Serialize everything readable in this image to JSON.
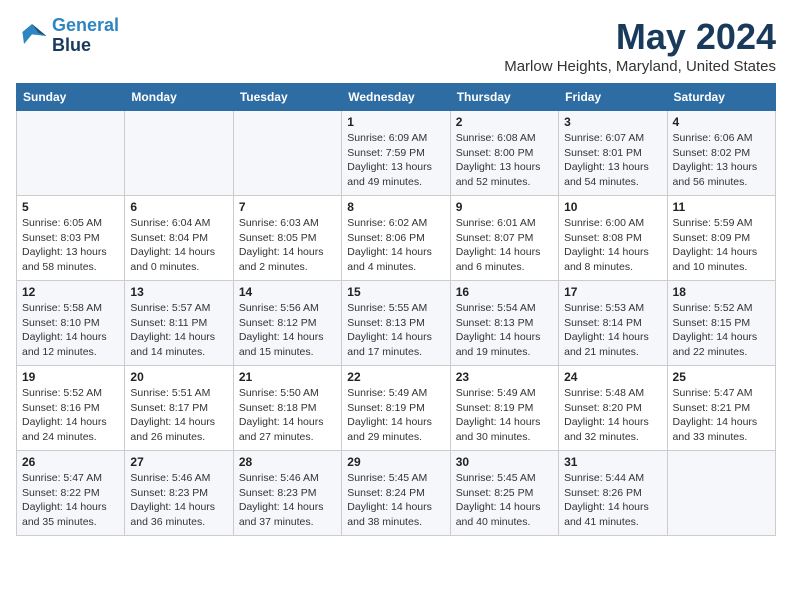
{
  "logo": {
    "line1": "General",
    "line2": "Blue"
  },
  "title": "May 2024",
  "location": "Marlow Heights, Maryland, United States",
  "weekdays": [
    "Sunday",
    "Monday",
    "Tuesday",
    "Wednesday",
    "Thursday",
    "Friday",
    "Saturday"
  ],
  "weeks": [
    [
      {
        "day": "",
        "info": ""
      },
      {
        "day": "",
        "info": ""
      },
      {
        "day": "",
        "info": ""
      },
      {
        "day": "1",
        "info": "Sunrise: 6:09 AM\nSunset: 7:59 PM\nDaylight: 13 hours\nand 49 minutes."
      },
      {
        "day": "2",
        "info": "Sunrise: 6:08 AM\nSunset: 8:00 PM\nDaylight: 13 hours\nand 52 minutes."
      },
      {
        "day": "3",
        "info": "Sunrise: 6:07 AM\nSunset: 8:01 PM\nDaylight: 13 hours\nand 54 minutes."
      },
      {
        "day": "4",
        "info": "Sunrise: 6:06 AM\nSunset: 8:02 PM\nDaylight: 13 hours\nand 56 minutes."
      }
    ],
    [
      {
        "day": "5",
        "info": "Sunrise: 6:05 AM\nSunset: 8:03 PM\nDaylight: 13 hours\nand 58 minutes."
      },
      {
        "day": "6",
        "info": "Sunrise: 6:04 AM\nSunset: 8:04 PM\nDaylight: 14 hours\nand 0 minutes."
      },
      {
        "day": "7",
        "info": "Sunrise: 6:03 AM\nSunset: 8:05 PM\nDaylight: 14 hours\nand 2 minutes."
      },
      {
        "day": "8",
        "info": "Sunrise: 6:02 AM\nSunset: 8:06 PM\nDaylight: 14 hours\nand 4 minutes."
      },
      {
        "day": "9",
        "info": "Sunrise: 6:01 AM\nSunset: 8:07 PM\nDaylight: 14 hours\nand 6 minutes."
      },
      {
        "day": "10",
        "info": "Sunrise: 6:00 AM\nSunset: 8:08 PM\nDaylight: 14 hours\nand 8 minutes."
      },
      {
        "day": "11",
        "info": "Sunrise: 5:59 AM\nSunset: 8:09 PM\nDaylight: 14 hours\nand 10 minutes."
      }
    ],
    [
      {
        "day": "12",
        "info": "Sunrise: 5:58 AM\nSunset: 8:10 PM\nDaylight: 14 hours\nand 12 minutes."
      },
      {
        "day": "13",
        "info": "Sunrise: 5:57 AM\nSunset: 8:11 PM\nDaylight: 14 hours\nand 14 minutes."
      },
      {
        "day": "14",
        "info": "Sunrise: 5:56 AM\nSunset: 8:12 PM\nDaylight: 14 hours\nand 15 minutes."
      },
      {
        "day": "15",
        "info": "Sunrise: 5:55 AM\nSunset: 8:13 PM\nDaylight: 14 hours\nand 17 minutes."
      },
      {
        "day": "16",
        "info": "Sunrise: 5:54 AM\nSunset: 8:13 PM\nDaylight: 14 hours\nand 19 minutes."
      },
      {
        "day": "17",
        "info": "Sunrise: 5:53 AM\nSunset: 8:14 PM\nDaylight: 14 hours\nand 21 minutes."
      },
      {
        "day": "18",
        "info": "Sunrise: 5:52 AM\nSunset: 8:15 PM\nDaylight: 14 hours\nand 22 minutes."
      }
    ],
    [
      {
        "day": "19",
        "info": "Sunrise: 5:52 AM\nSunset: 8:16 PM\nDaylight: 14 hours\nand 24 minutes."
      },
      {
        "day": "20",
        "info": "Sunrise: 5:51 AM\nSunset: 8:17 PM\nDaylight: 14 hours\nand 26 minutes."
      },
      {
        "day": "21",
        "info": "Sunrise: 5:50 AM\nSunset: 8:18 PM\nDaylight: 14 hours\nand 27 minutes."
      },
      {
        "day": "22",
        "info": "Sunrise: 5:49 AM\nSunset: 8:19 PM\nDaylight: 14 hours\nand 29 minutes."
      },
      {
        "day": "23",
        "info": "Sunrise: 5:49 AM\nSunset: 8:19 PM\nDaylight: 14 hours\nand 30 minutes."
      },
      {
        "day": "24",
        "info": "Sunrise: 5:48 AM\nSunset: 8:20 PM\nDaylight: 14 hours\nand 32 minutes."
      },
      {
        "day": "25",
        "info": "Sunrise: 5:47 AM\nSunset: 8:21 PM\nDaylight: 14 hours\nand 33 minutes."
      }
    ],
    [
      {
        "day": "26",
        "info": "Sunrise: 5:47 AM\nSunset: 8:22 PM\nDaylight: 14 hours\nand 35 minutes."
      },
      {
        "day": "27",
        "info": "Sunrise: 5:46 AM\nSunset: 8:23 PM\nDaylight: 14 hours\nand 36 minutes."
      },
      {
        "day": "28",
        "info": "Sunrise: 5:46 AM\nSunset: 8:23 PM\nDaylight: 14 hours\nand 37 minutes."
      },
      {
        "day": "29",
        "info": "Sunrise: 5:45 AM\nSunset: 8:24 PM\nDaylight: 14 hours\nand 38 minutes."
      },
      {
        "day": "30",
        "info": "Sunrise: 5:45 AM\nSunset: 8:25 PM\nDaylight: 14 hours\nand 40 minutes."
      },
      {
        "day": "31",
        "info": "Sunrise: 5:44 AM\nSunset: 8:26 PM\nDaylight: 14 hours\nand 41 minutes."
      },
      {
        "day": "",
        "info": ""
      }
    ]
  ]
}
